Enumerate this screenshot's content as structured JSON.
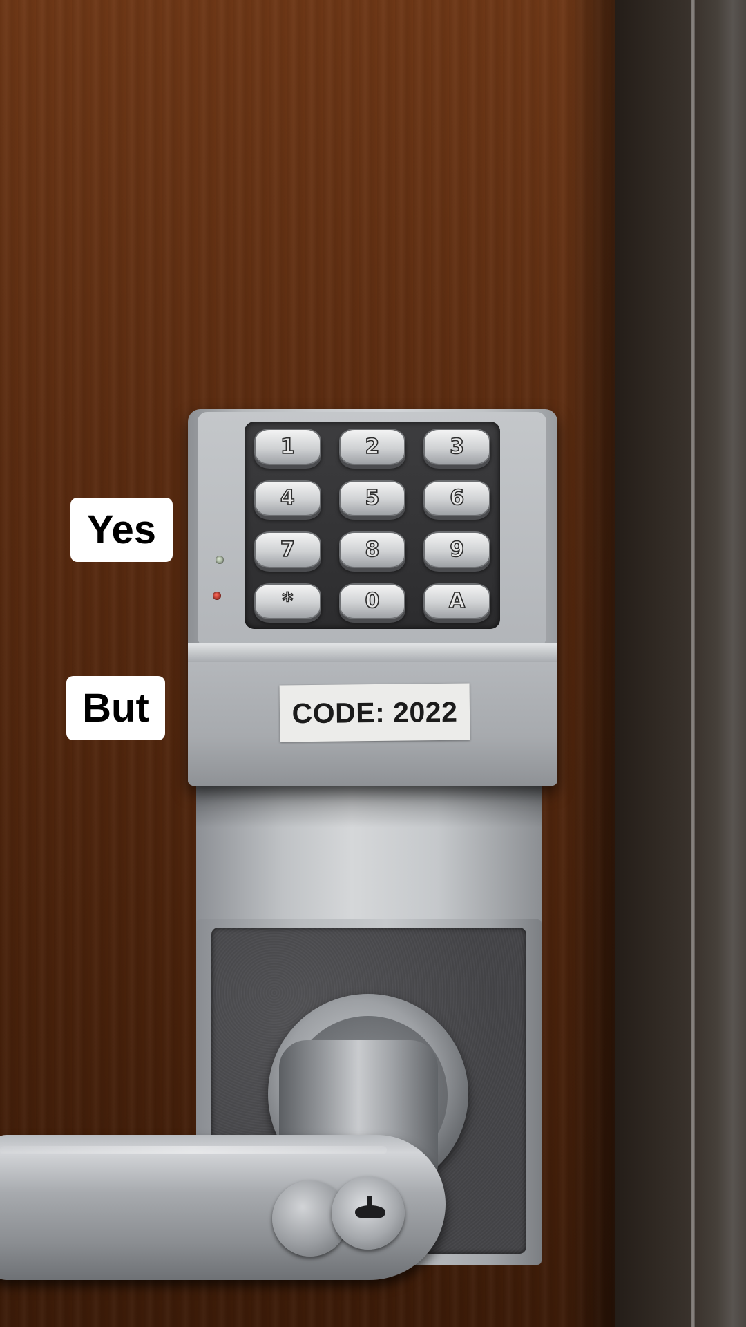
{
  "captions": {
    "first": "Yes",
    "second": "But"
  },
  "lock": {
    "keys": [
      "1",
      "2",
      "3",
      "4",
      "5",
      "6",
      "7",
      "8",
      "9",
      "*",
      "0",
      "A"
    ],
    "label": "CODE: 2022",
    "indicators": [
      "green-led",
      "red-led"
    ]
  },
  "colors": {
    "door": "#5a2b10",
    "frame": "#2f2822",
    "metal": "#c0c3c6",
    "keypad_bezel": "#2c2c2e",
    "caption_bg": "#ffffff",
    "caption_text": "#000000"
  }
}
